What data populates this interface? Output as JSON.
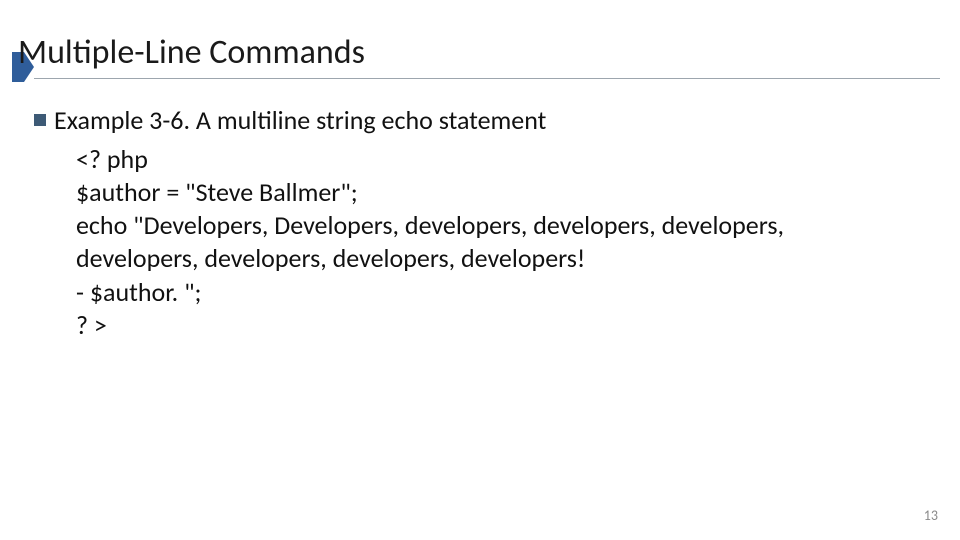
{
  "slide": {
    "title": "Multiple-Line Commands",
    "bullet": "Example 3-6. A multiline string echo statement",
    "code": "<? php\n$author = \"Steve Ballmer\";\necho \"Developers, Developers, developers, developers, developers,\ndevelopers, developers, developers, developers!\n- $author. \";\n? >",
    "page_number": "13"
  },
  "colors": {
    "accent": "#2f5d9a",
    "bullet": "#3d5a76",
    "rule": "#5b6a78",
    "pagenum": "#8a8a8a"
  }
}
